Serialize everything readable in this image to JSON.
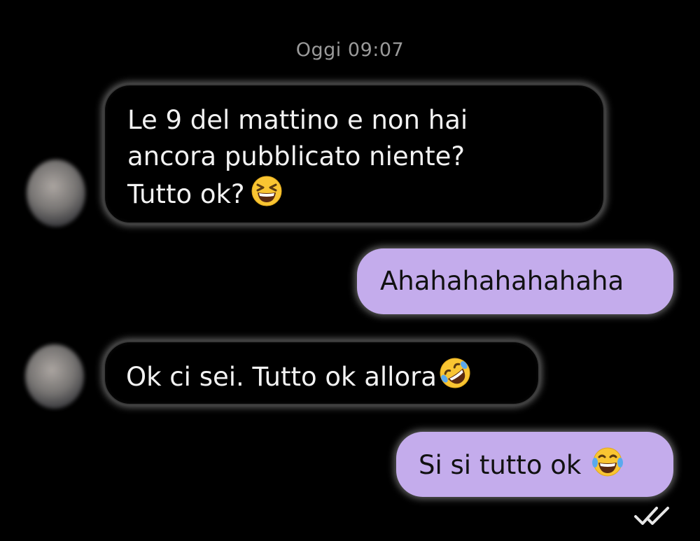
{
  "chat": {
    "date_divider": "Oggi 09:07",
    "messages": [
      {
        "direction": "incoming",
        "lines": [
          "Le 9 del mattino e non hai",
          "ancora pubblicato niente?",
          "Tutto ok?"
        ],
        "emoji": "grinning-squinting-face"
      },
      {
        "direction": "outgoing",
        "text": "Ahahahahahahaha"
      },
      {
        "direction": "incoming",
        "text": "Ok ci sei. Tutto ok allora",
        "emoji": "rolling-on-floor-laughing-face"
      },
      {
        "direction": "outgoing",
        "text": "Si si tutto ok",
        "emoji": "face-with-tears-of-joy"
      }
    ],
    "read_status_icon": "double-check-icon"
  },
  "colors": {
    "background": "#000000",
    "outgoing_bubble": "#c4acec",
    "incoming_bubble": "#000000",
    "timestamp_text": "#9a9a9a",
    "emoji_yellow": "#f9c532"
  }
}
